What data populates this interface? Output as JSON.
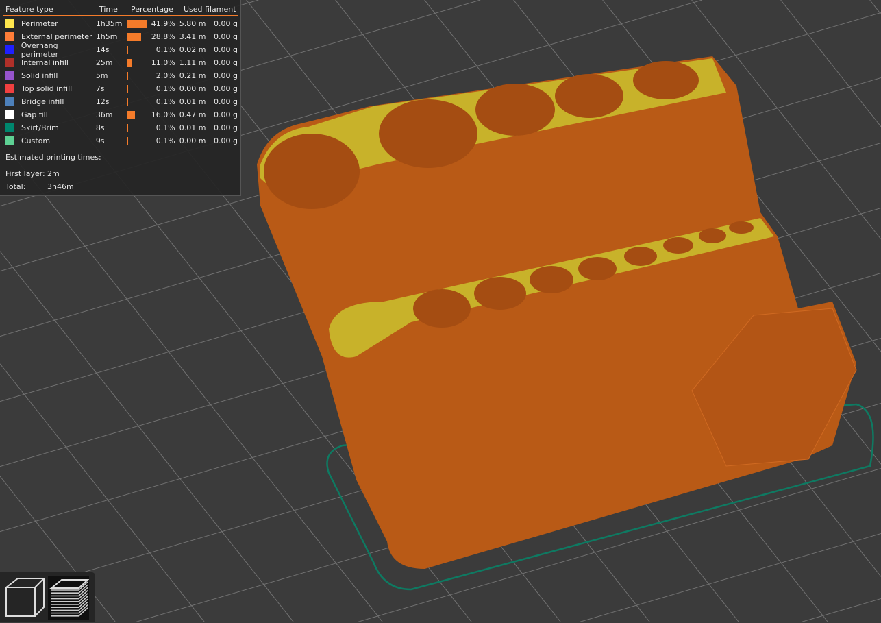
{
  "legend": {
    "headers": {
      "feature": "Feature type",
      "time": "Time",
      "percentage": "Percentage",
      "filament": "Used filament"
    },
    "rows": [
      {
        "name": "Perimeter",
        "color": "#ffe64d",
        "time": "1h35m",
        "pct": "41.9%",
        "pct_value": 41.9,
        "length": "5.80 m",
        "weight": "0.00 g"
      },
      {
        "name": "External perimeter",
        "color": "#ff7d38",
        "time": "1h5m",
        "pct": "28.8%",
        "pct_value": 28.8,
        "length": "3.41 m",
        "weight": "0.00 g"
      },
      {
        "name": "Overhang perimeter",
        "color": "#1f1fff",
        "time": "14s",
        "pct": "0.1%",
        "pct_value": 0.1,
        "length": "0.02 m",
        "weight": "0.00 g"
      },
      {
        "name": "Internal infill",
        "color": "#b03029",
        "time": "25m",
        "pct": "11.0%",
        "pct_value": 11.0,
        "length": "1.11 m",
        "weight": "0.00 g"
      },
      {
        "name": "Solid infill",
        "color": "#9654cc",
        "time": "5m",
        "pct": "2.0%",
        "pct_value": 2.0,
        "length": "0.21 m",
        "weight": "0.00 g"
      },
      {
        "name": "Top solid infill",
        "color": "#f04040",
        "time": "7s",
        "pct": "0.1%",
        "pct_value": 0.1,
        "length": "0.00 m",
        "weight": "0.00 g"
      },
      {
        "name": "Bridge infill",
        "color": "#4d80ba",
        "time": "12s",
        "pct": "0.1%",
        "pct_value": 0.1,
        "length": "0.01 m",
        "weight": "0.00 g"
      },
      {
        "name": "Gap fill",
        "color": "#ffffff",
        "time": "36m",
        "pct": "16.0%",
        "pct_value": 16.0,
        "length": "0.47 m",
        "weight": "0.00 g"
      },
      {
        "name": "Skirt/Brim",
        "color": "#00876e",
        "time": "8s",
        "pct": "0.1%",
        "pct_value": 0.1,
        "length": "0.01 m",
        "weight": "0.00 g"
      },
      {
        "name": "Custom",
        "color": "#5ed194",
        "time": "9s",
        "pct": "0.1%",
        "pct_value": 0.1,
        "length": "0.00 m",
        "weight": "0.00 g"
      }
    ],
    "estimated_title": "Estimated printing times:",
    "first_layer_label": "First layer:",
    "first_layer": "2m",
    "total_label": "Total:",
    "total": "3h46m"
  },
  "view_buttons": {
    "icons": [
      "cube-3d-view-icon",
      "layers-view-icon"
    ]
  }
}
